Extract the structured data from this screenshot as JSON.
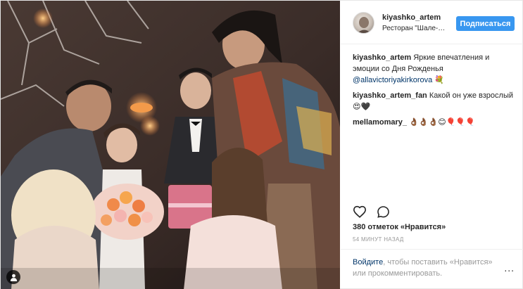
{
  "post": {
    "username": "kiyashko_artem",
    "location": "Ресторан \"Шале-Б...",
    "follow_label": "Подписаться",
    "comments": [
      {
        "user": "kiyashko_artem",
        "text": "Яркие впечатления и эмоции со Дня Рожденья",
        "mention": "@allavictoriyakirkorova",
        "emoji": "💐"
      },
      {
        "user": "kiyashko_artem_fan",
        "text": "Какой он уже взрослый",
        "emoji": "😍🖤"
      },
      {
        "user": "mellamomary_",
        "text": "",
        "emoji": "👌🏾👌🏾👌🏾😊🎈🎈🎈"
      }
    ],
    "likes": "380 отметок «Нравится»",
    "timestamp": "54 МИНУТ НАЗАД",
    "login_prompt": {
      "link": "Войдите",
      "text": ", чтобы поставить «Нравится» или прокомментировать."
    },
    "more_label": "...",
    "icons": {
      "like": "heart-icon",
      "comment": "comment-icon",
      "tag": "user-tag-icon",
      "more": "more-options-icon"
    },
    "colors": {
      "accent": "#3897f0",
      "link": "#003569",
      "muted": "#999999",
      "text": "#262626"
    }
  }
}
